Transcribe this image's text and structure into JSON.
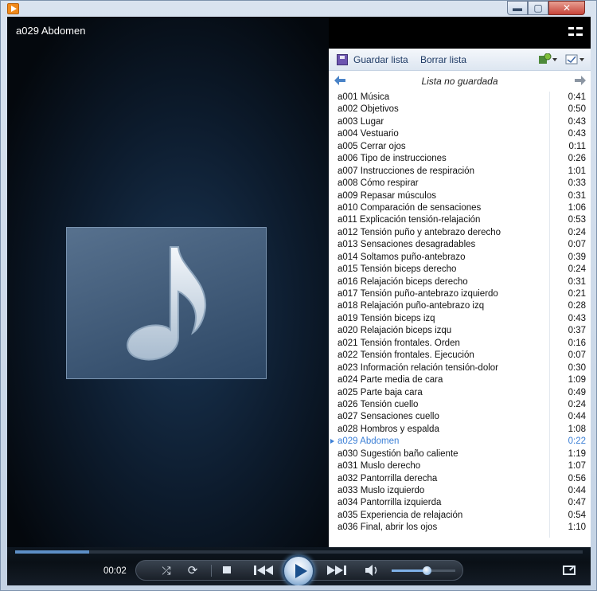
{
  "window": {
    "app_icon": "media-player-icon",
    "minimize": "▬",
    "maximize": "▢",
    "close": "✕"
  },
  "video": {
    "now_playing": "a029 Abdomen",
    "art_icon": "music-note-icon"
  },
  "playlist": {
    "save_label": "Guardar lista",
    "clear_label": "Borrar lista",
    "name": "Lista no guardada",
    "current_index": 28,
    "current_color": "#3b7fd6",
    "tracks": [
      {
        "title": "a001 Música",
        "duration": "0:41"
      },
      {
        "title": "a002 Objetivos",
        "duration": "0:50"
      },
      {
        "title": "a003 Lugar",
        "duration": "0:43"
      },
      {
        "title": "a004 Vestuario",
        "duration": "0:43"
      },
      {
        "title": "a005 Cerrar ojos",
        "duration": "0:11"
      },
      {
        "title": "a006 Tipo de instrucciones",
        "duration": "0:26"
      },
      {
        "title": "a007 Instrucciones de respiración",
        "duration": "1:01"
      },
      {
        "title": "a008 Cómo respirar",
        "duration": "0:33"
      },
      {
        "title": "a009 Repasar músculos",
        "duration": "0:31"
      },
      {
        "title": "a010 Comparación de sensaciones",
        "duration": "1:06"
      },
      {
        "title": "a011 Explicación tensión-relajación",
        "duration": "0:53"
      },
      {
        "title": "a012 Tensión  puño y antebrazo derecho",
        "duration": "0:24"
      },
      {
        "title": "a013 Sensaciones desagradables",
        "duration": "0:07"
      },
      {
        "title": "a014 Soltamos puño-antebrazo",
        "duration": "0:39"
      },
      {
        "title": "a015 Tensión biceps derecho",
        "duration": "0:24"
      },
      {
        "title": "a016 Relajación biceps derecho",
        "duration": "0:31"
      },
      {
        "title": "a017 Tensión puño-antebrazo izquierdo",
        "duration": "0:21"
      },
      {
        "title": "a018 Relajación puño-antebrazo izq",
        "duration": "0:28"
      },
      {
        "title": "a019 Tensión biceps izq",
        "duration": "0:43"
      },
      {
        "title": "a020 Relajación biceps izqu",
        "duration": "0:37"
      },
      {
        "title": "a021 Tensión frontales. Orden",
        "duration": "0:16"
      },
      {
        "title": "a022 Tensión frontales. Ejecución",
        "duration": "0:07"
      },
      {
        "title": "a023 Información relación tensión-dolor",
        "duration": "0:30"
      },
      {
        "title": "a024 Parte media de cara",
        "duration": "1:09"
      },
      {
        "title": "a025 Parte baja cara",
        "duration": "0:49"
      },
      {
        "title": "a026 Tensión cuello",
        "duration": "0:24"
      },
      {
        "title": "a027 Sensaciones cuello",
        "duration": "0:44"
      },
      {
        "title": "a028 Hombros y espalda",
        "duration": "1:08"
      },
      {
        "title": "a029 Abdomen",
        "duration": "0:22"
      },
      {
        "title": "a030 Sugestión baño caliente",
        "duration": "1:19"
      },
      {
        "title": "a031 Muslo derecho",
        "duration": "1:07"
      },
      {
        "title": "a032 Pantorrilla derecha",
        "duration": "0:56"
      },
      {
        "title": "a033 Muslo izquierdo",
        "duration": "0:44"
      },
      {
        "title": "a034 Pantorrilla izquierda",
        "duration": "0:47"
      },
      {
        "title": "a035 Experiencia de relajación",
        "duration": "0:54"
      },
      {
        "title": "a036 Final, abrir los ojos",
        "duration": "1:10"
      }
    ]
  },
  "controls": {
    "elapsed": "00:02",
    "seek_progress": 0.13,
    "volume_level": 0.55,
    "shuffle": "⤮",
    "repeat": "⟳",
    "accent": "#5d8fc6"
  }
}
